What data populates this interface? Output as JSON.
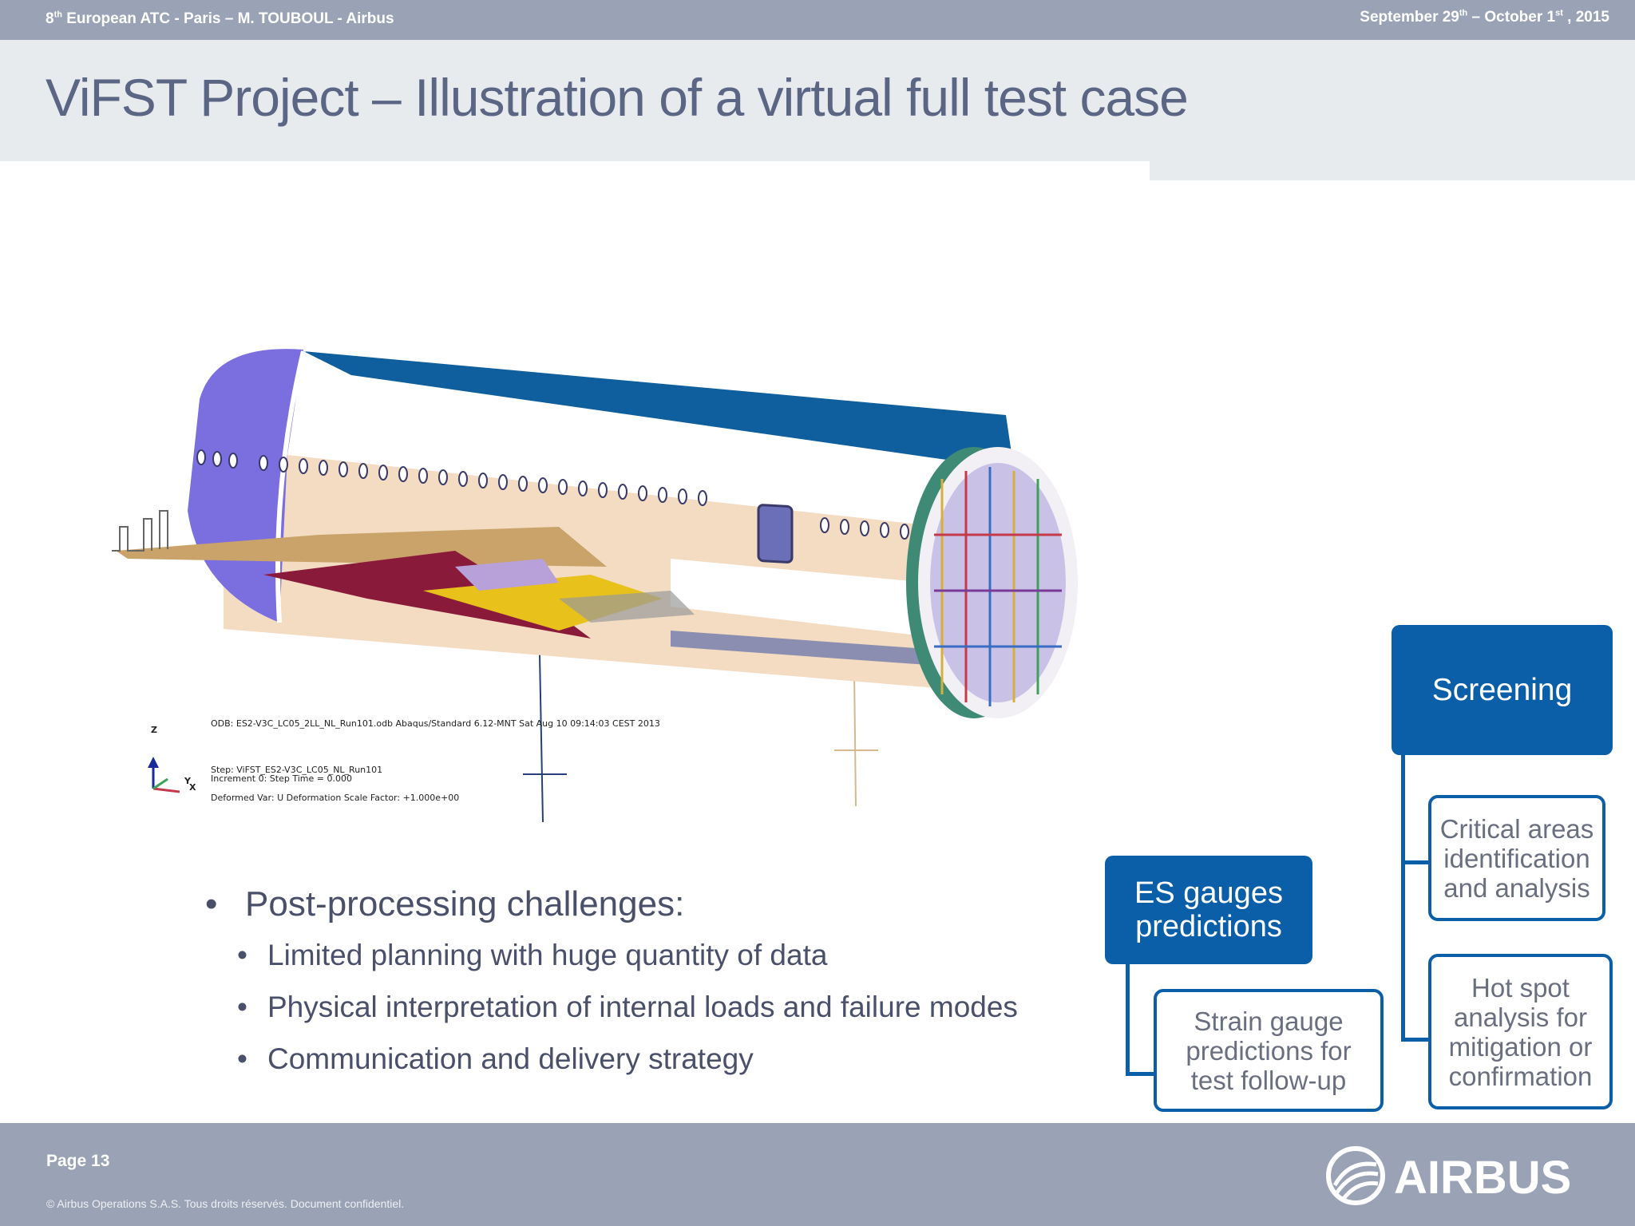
{
  "header": {
    "event_prefix": "8",
    "event_sup": "th",
    "event_rest": " European ATC - Paris – M. TOUBOUL - Airbus",
    "date_start": "September 29",
    "date_start_sup": "th",
    "date_mid": " – October 1",
    "date_end_sup": "st",
    "date_end": " , 2015"
  },
  "title": "ViFST Project – Illustration of a virtual full test case",
  "figure": {
    "odb_line": "ODB: ES2-V3C_LC05_2LL_NL_Run101.odb    Abaqus/Standard 6.12-MNT    Sat Aug 10 09:14:03 CEST 2013",
    "step_line": "Step: ViFST_ES2-V3C_LC05_NL_Run101",
    "increment_line": "Increment      0: Step Time =     0.000",
    "deformed_line": "Deformed Var: U   Deformation Scale Factor: +1.000e+00",
    "axis_z": "Z",
    "axis_y": "Y",
    "axis_x": "X"
  },
  "bullets": {
    "main": "Post-processing challenges:",
    "items": [
      "Limited planning with huge quantity of data",
      "Physical interpretation of internal loads and failure modes",
      "Communication and delivery strategy"
    ]
  },
  "diagram": {
    "es_gauges": [
      "ES gauges",
      "predictions"
    ],
    "strain_gauge": [
      "Strain gauge",
      "predictions for",
      "test follow-up"
    ],
    "screening": "Screening",
    "critical_areas": [
      "Critical areas",
      "identification",
      "and analysis"
    ],
    "hot_spot": [
      "Hot spot",
      "analysis for",
      "mitigation or",
      "confirmation"
    ]
  },
  "footer": {
    "page": "Page 13",
    "copyright": "© Airbus Operations S.A.S. Tous droits réservés. Document confidentiel.",
    "logo_text": "AIRBUS"
  },
  "colors": {
    "bar": "#9aa3b5",
    "accent": "#0b5fa8",
    "title": "#5b6584"
  }
}
